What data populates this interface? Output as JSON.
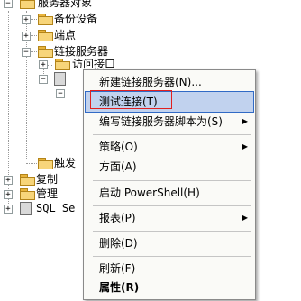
{
  "tree": {
    "server_objects": "服务器对象",
    "backup_devices": "备份设备",
    "endpoints": "端点",
    "linked_servers": "链接服务器",
    "providers": "访问接口",
    "triggers_partial": "触发",
    "replication": "复制",
    "management": "管理",
    "sql_agent_partial": "SQL Se"
  },
  "context_menu": {
    "items": [
      {
        "label": "新建链接服务器(N)...",
        "submenu": false
      },
      {
        "label": "测试连接(T)",
        "submenu": false,
        "highlighted": true
      },
      {
        "label": "编写链接服务器脚本为(S)",
        "submenu": true
      },
      {
        "label": "策略(O)",
        "submenu": true
      },
      {
        "label": "方面(A)",
        "submenu": false
      },
      {
        "label": "启动 PowerShell(H)",
        "submenu": false
      },
      {
        "label": "报表(P)",
        "submenu": true
      },
      {
        "label": "删除(D)",
        "submenu": false
      },
      {
        "label": "刷新(F)",
        "submenu": false
      },
      {
        "label": "属性(R)",
        "submenu": false,
        "bold": true
      }
    ],
    "submenu_arrow": "▶"
  },
  "colors": {
    "highlight_bg": "#c1d2ee",
    "highlight_border": "#316ac5",
    "red_box": "#e02020"
  }
}
